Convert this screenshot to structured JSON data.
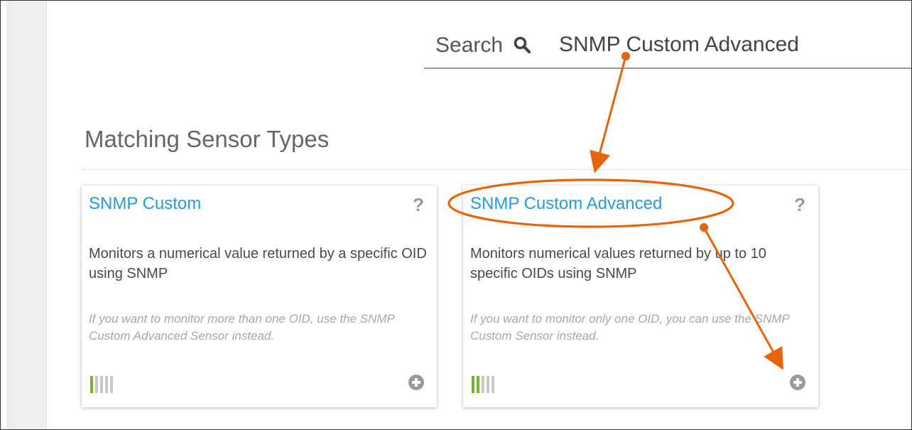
{
  "search": {
    "label": "Search",
    "value": "SNMP Custom Advanced"
  },
  "section": {
    "title": "Matching Sensor Types"
  },
  "cards": [
    {
      "title": "SNMP Custom",
      "help": "?",
      "description": "Monitors a numerical value returned by a specific OID using SNMP",
      "hint": "If you want to monitor more than one OID, use the SNMP Custom Advanced Sensor instead.",
      "performance_level": 1,
      "performance_max": 5
    },
    {
      "title": "SNMP Custom Advanced",
      "help": "?",
      "description": "Monitors numerical values returned by up to 10 specific OIDs using SNMP",
      "hint": "If you want to monitor only one OID, you can use the SNMP Custom Sensor instead.",
      "performance_level": 2,
      "performance_max": 5
    }
  ],
  "colors": {
    "link": "#2a9ad8",
    "annotation": "#e8640c",
    "bar_active": "#7ab326",
    "bar_inactive": "#c8c8c8",
    "icon_gray": "#9a9a9a"
  },
  "icons": {
    "search": "search-icon",
    "help": "help-icon",
    "add": "add-icon"
  }
}
